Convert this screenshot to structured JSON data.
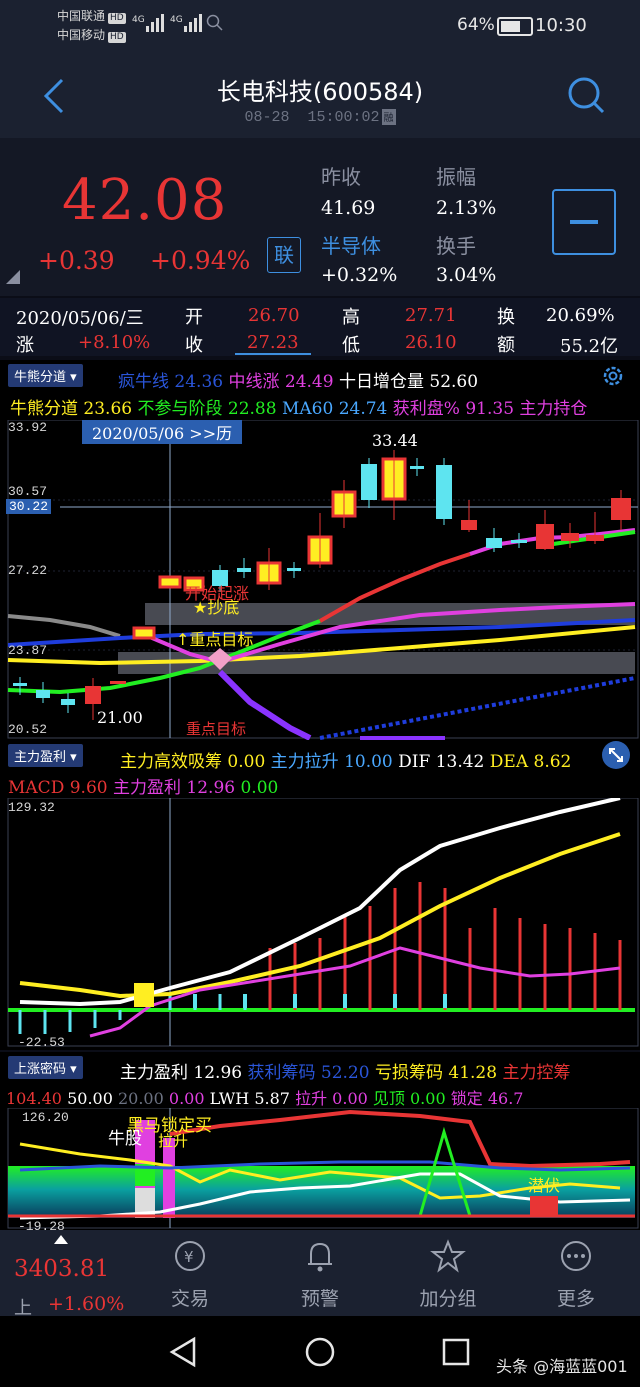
{
  "status": {
    "carrier1": "中国联通",
    "carrier2": "中国移动",
    "hd": "HD",
    "net": "4G",
    "battery": "64%",
    "time": "10:30"
  },
  "header": {
    "title": "长电科技(600584)",
    "date": "08-28",
    "time": "15:00:02",
    "flag": "融",
    "back_icon": "chevron-left-icon",
    "search_icon": "search-icon"
  },
  "quote": {
    "price": "42.08",
    "change": "+0.39",
    "change_pct": "+0.94%",
    "link_label": "联",
    "prev_close_label": "昨收",
    "prev_close": "41.69",
    "amplitude_label": "振幅",
    "amplitude": "2.13%",
    "sector_label": "半导体",
    "sector_change": "+0.32%",
    "turnover_label": "换手",
    "turnover": "3.04%",
    "colors": {
      "up": "#e83535",
      "accent": "#3e8fe0"
    }
  },
  "summary": {
    "date": "2020/05/06/三",
    "rise_label": "涨",
    "rise": "+8.10%",
    "open_label": "开",
    "open": "26.70",
    "close_label": "收",
    "close": "27.23",
    "high_label": "高",
    "high": "27.71",
    "low_label": "低",
    "low": "26.10",
    "turn_label": "换",
    "turn": "20.69%",
    "amount_label": "额",
    "amount": "55.2亿"
  },
  "chart1": {
    "selector": "牛熊分道",
    "ind_row1": [
      {
        "label": "疯牛线",
        "value": "24.36",
        "color": "#2a55d8"
      },
      {
        "label": "中线涨",
        "value": "24.49",
        "color": "#e040e0"
      },
      {
        "label": "十日增仓量",
        "value": "52.60",
        "color": "#ffffff"
      }
    ],
    "ind_row2": [
      {
        "label": "牛熊分道",
        "value": "23.66",
        "color": "#ffee22"
      },
      {
        "label": "不参与阶段",
        "value": "22.88",
        "color": "#22ee22"
      },
      {
        "label": "MA60",
        "value": "24.74",
        "color": "#4aa8ff"
      },
      {
        "label": "获利盘%",
        "value": "91.35",
        "color": "#e040e0"
      },
      {
        "label": "主力持仓",
        "value": "",
        "color": "#e040e0"
      }
    ],
    "y_top": "33.92",
    "y_2": "30.57",
    "y_cur": "30.22",
    "y_3": "27.22",
    "y_4": "23.87",
    "y_bottom": "20.52",
    "cursor_date": "2020/05/06 >>历",
    "high_mark": "33.44",
    "low_mark": "21.00",
    "annot_start": "开始起涨",
    "annot_bottom": "★抄底",
    "annot_target": "↑重点目标",
    "annot_target2": "重点目标",
    "gear_icon": "gear-icon"
  },
  "chart2": {
    "selector": "主力盈利",
    "ind_row1": [
      {
        "label": "主力高效吸筹",
        "value": "0.00",
        "color": "#ffee22"
      },
      {
        "label": "主力拉升",
        "value": "10.00",
        "color": "#4aa8ff"
      },
      {
        "label": "DIF",
        "value": "13.42",
        "color": "#ffffff"
      },
      {
        "label": "DEA",
        "value": "8.62",
        "color": "#ffee22"
      }
    ],
    "ind_row2": [
      {
        "label": "MACD",
        "value": "9.60",
        "color": "#e83535"
      },
      {
        "label": "主力盈利",
        "value": "12.96",
        "color": "#e040e0"
      },
      {
        "label": "",
        "value": "0.00",
        "color": "#22ee22"
      }
    ],
    "y_top": "129.32",
    "y_bottom": "-22.53",
    "expand_icon": "expand-icon"
  },
  "chart3": {
    "selector": "上涨密码",
    "ind_row1": [
      {
        "label": "主力盈利",
        "value": "12.96",
        "color": "#ffffff"
      },
      {
        "label": "获利筹码",
        "value": "52.20",
        "color": "#2a55d8"
      },
      {
        "label": "亏损筹码",
        "value": "41.28",
        "color": "#ffee22"
      },
      {
        "label": "主力控筹",
        "value": "",
        "color": "#e83535"
      }
    ],
    "ind_row2": [
      {
        "label": "",
        "value": "104.40",
        "color": "#e83535"
      },
      {
        "label": "",
        "value": "50.00",
        "color": "#ffffff"
      },
      {
        "label": "",
        "value": "20.00",
        "color": "#6c7282"
      },
      {
        "label": "",
        "value": "0.00",
        "color": "#e040e0"
      },
      {
        "label": "LWH",
        "value": "5.87",
        "color": "#ffffff"
      },
      {
        "label": "拉升",
        "value": "0.00",
        "color": "#e040e0"
      },
      {
        "label": "见顶",
        "value": "0.00",
        "color": "#22ee22"
      },
      {
        "label": "锁定",
        "value": "46.7",
        "color": "#e040e0"
      }
    ],
    "y_top": "126.20",
    "y_bottom": "-19.28",
    "annot1": "黑马锁定买",
    "annot2": "牛股",
    "annot3": "拉升",
    "annot4": "潜伏"
  },
  "bottom": {
    "index_value": "3403.81",
    "index_label": "上",
    "index_change": "+1.60%",
    "items": [
      {
        "label": "交易",
        "icon": "yuan-exchange-icon"
      },
      {
        "label": "预警",
        "icon": "bell-icon"
      },
      {
        "label": "加分组",
        "icon": "star-icon"
      },
      {
        "label": "更多",
        "icon": "more-icon"
      }
    ]
  },
  "watermark": "头条 @海蓝蓝001"
}
